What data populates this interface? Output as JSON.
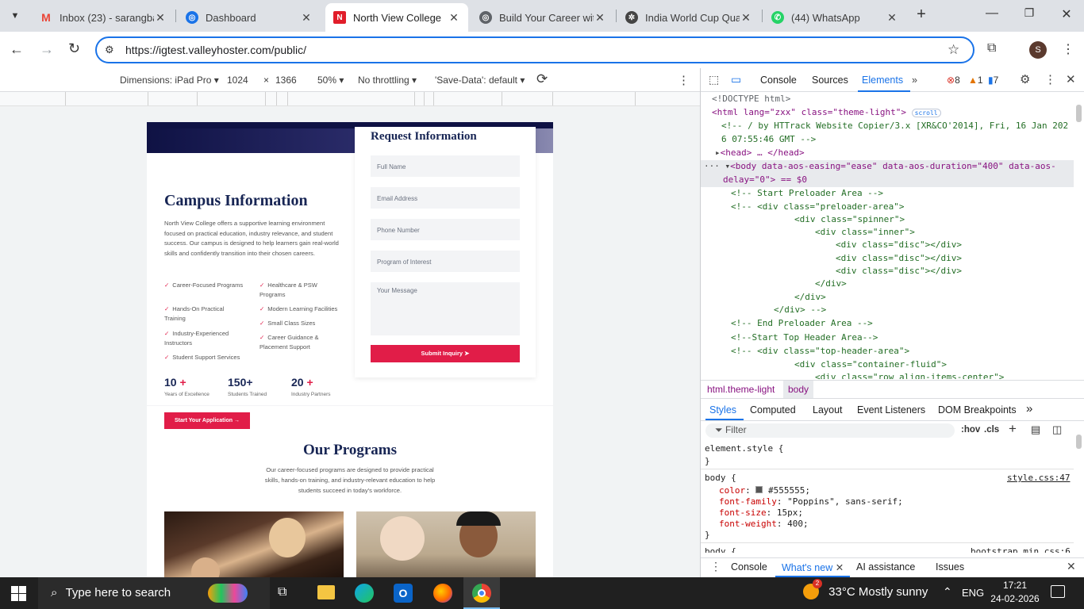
{
  "browser": {
    "tabs": [
      {
        "title": "Inbox (23) - sarangba",
        "favicon": "gmail-icon",
        "color": "#ea4335",
        "active": false
      },
      {
        "title": "Dashboard",
        "favicon": "globe-icon",
        "color": "#1a73e8",
        "active": false
      },
      {
        "title": "North View College",
        "favicon": "n-logo-icon",
        "color": "#e11d2a",
        "active": true
      },
      {
        "title": "Build Your Career wit",
        "favicon": "globe-icon",
        "color": "#5f6368",
        "active": false
      },
      {
        "title": "India World Cup Qua",
        "favicon": "openai-icon",
        "color": "#444",
        "active": false
      },
      {
        "title": "(44) WhatsApp",
        "favicon": "whatsapp-icon",
        "color": "#25d366",
        "active": false
      }
    ],
    "url": "https://igtest.valleyhoster.com/public/",
    "profile_initial": "S"
  },
  "device_toolbar": {
    "dimensions_label": "Dimensions: iPad Pro",
    "width": "1024",
    "height": "1366",
    "zoom": "50%",
    "throttling": "No throttling",
    "save_data": "'Save-Data': default"
  },
  "site": {
    "form": {
      "title": "Request Information",
      "fields": [
        "Full Name",
        "Email Address",
        "Phone Number",
        "Program of Interest"
      ],
      "message_placeholder": "Your Message",
      "submit_label": "Submit Inquiry"
    },
    "campus": {
      "title": "Campus Information",
      "description": "North View College offers a supportive learning environment focused on practical education, industry relevance, and student success. Our campus is designed to help learners gain real-world skills and confidently transition into their chosen careers.",
      "features_left": [
        "Career-Focused Programs",
        "Hands-On Practical Training",
        "Industry-Experienced Instructors",
        "Student Support Services"
      ],
      "features_right": [
        "Healthcare & PSW Programs",
        "Modern Learning Facilities",
        "Small Class Sizes",
        "Career Guidance & Placement Support"
      ],
      "stats": [
        {
          "value": "10",
          "suffix": "+",
          "label": "Years of Excellence"
        },
        {
          "value": "150",
          "suffix": "+",
          "label": "Students Trained"
        },
        {
          "value": "20",
          "suffix": "+",
          "label": "Industry Partners"
        }
      ],
      "cta_label": "Start Your Application"
    },
    "programs": {
      "title": "Our Programs",
      "description": "Our career-focused programs are designed to provide practical skills, hands-on training, and industry-relevant education to help students succeed in today's workforce."
    }
  },
  "devtools": {
    "tabs": [
      "Console",
      "Sources",
      "Elements"
    ],
    "active_tab": "Elements",
    "errors": "8",
    "warnings": "1",
    "issues": "7",
    "dom_lines": [
      "<!DOCTYPE html>",
      "<html lang=\"zxx\" class=\"theme-light\">",
      "<!-- / by HTTrack Website Copier/3.x [XR&CO'2014], Fri, 16 Jan 202",
      "6 07:55:46 GMT -->",
      "<head> … </head>",
      "<body data-aos-easing=\"ease\" data-aos-duration=\"400\" data-aos-",
      "delay=\"0\"> == $0",
      "<!-- Start Preloader Area -->",
      "<!-- <div class=\"preloader-area\">",
      "<div class=\"spinner\">",
      "<div class=\"inner\">",
      "<div class=\"disc\"></div>",
      "<div class=\"disc\"></div>",
      "<div class=\"disc\"></div>",
      "</div>",
      "</div>",
      "</div> -->",
      "<!-- End Preloader Area -->",
      "<!--Start Top Header Area-->",
      "<!-- <div class=\"top-header-area\">",
      "<div class=\"container-fluid\">",
      "<div class=\"row align-items-center\">"
    ],
    "scroll_badge": "scroll",
    "breadcrumb": [
      "html.theme-light",
      "body"
    ],
    "style_tabs": [
      "Styles",
      "Computed",
      "Layout",
      "Event Listeners",
      "DOM Breakpoints"
    ],
    "filter_placeholder": "Filter",
    "hov": ":hov",
    "cls": ".cls",
    "element_style": "element.style {",
    "close_brace": "}",
    "rule_selector": "body {",
    "rule_source": "style.css:47",
    "rule_props": [
      {
        "name": "color",
        "value": "#555555;"
      },
      {
        "name": "font-family",
        "value": "\"Poppins\", sans-serif;"
      },
      {
        "name": "font-size",
        "value": "15px;"
      },
      {
        "name": "font-weight",
        "value": "400;"
      }
    ],
    "next_selector": "body {",
    "next_source": "bootstrap.min.css:6",
    "drawer_tabs": [
      "Console",
      "What's new",
      "AI assistance",
      "Issues"
    ]
  },
  "taskbar": {
    "search_placeholder": "Type here to search",
    "weather": "33°C  Mostly sunny",
    "language": "ENG",
    "time": "17:21",
    "date": "24-02-2026",
    "notif_count": "2"
  }
}
